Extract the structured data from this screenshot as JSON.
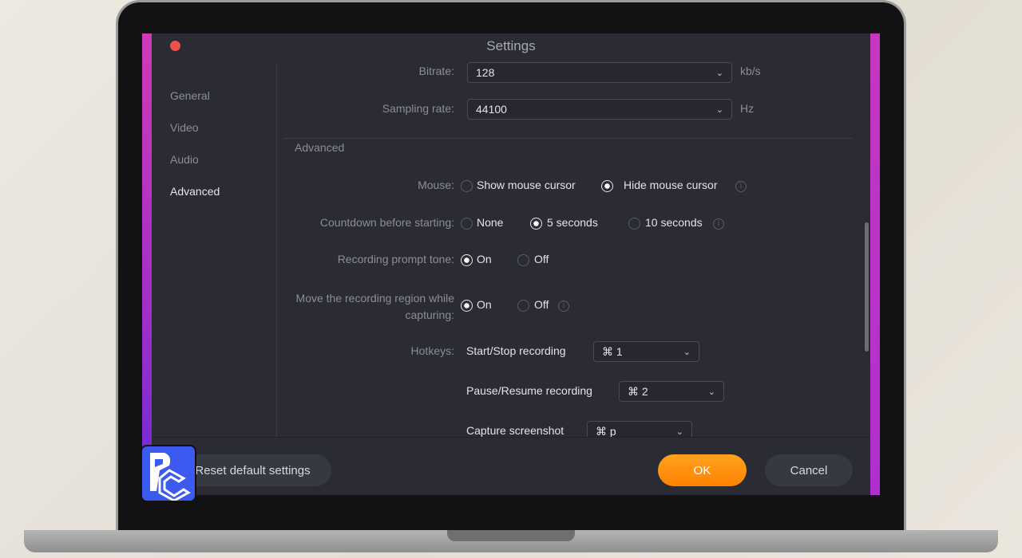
{
  "window": {
    "title": "Settings"
  },
  "sidebar": {
    "items": [
      {
        "label": "General"
      },
      {
        "label": "Video"
      },
      {
        "label": "Audio"
      },
      {
        "label": "Advanced",
        "active": true
      }
    ]
  },
  "audio": {
    "bitrate": {
      "label": "Bitrate:",
      "value": "128",
      "unit": "kb/s"
    },
    "sampling": {
      "label": "Sampling rate:",
      "value": "44100",
      "unit": "Hz"
    }
  },
  "advanced": {
    "heading": "Advanced",
    "mouse": {
      "label": "Mouse:",
      "options": [
        "Show mouse cursor",
        "Hide mouse cursor"
      ],
      "selected": "Hide mouse cursor"
    },
    "countdown": {
      "label": "Countdown before starting:",
      "options": [
        "None",
        "5 seconds",
        "10 seconds"
      ],
      "selected": "5 seconds"
    },
    "prompt": {
      "label": "Recording prompt tone:",
      "options": [
        "On",
        "Off"
      ],
      "selected": "On"
    },
    "move": {
      "label_line1": "Move the recording region while",
      "label_line2": "capturing:",
      "options": [
        "On",
        "Off"
      ],
      "selected": "On"
    },
    "hotkeys": {
      "label": "Hotkeys:",
      "items": [
        {
          "label": "Start/Stop recording",
          "value": "⌘ 1"
        },
        {
          "label": "Pause/Resume recording",
          "value": "⌘ 2"
        },
        {
          "label": "Capture screenshot",
          "value": "⌘ p"
        }
      ]
    }
  },
  "footer": {
    "reset": "Reset default settings",
    "ok": "OK",
    "cancel": "Cancel"
  },
  "colors": {
    "accent": "#ff8a00",
    "close": "#f0504a"
  }
}
